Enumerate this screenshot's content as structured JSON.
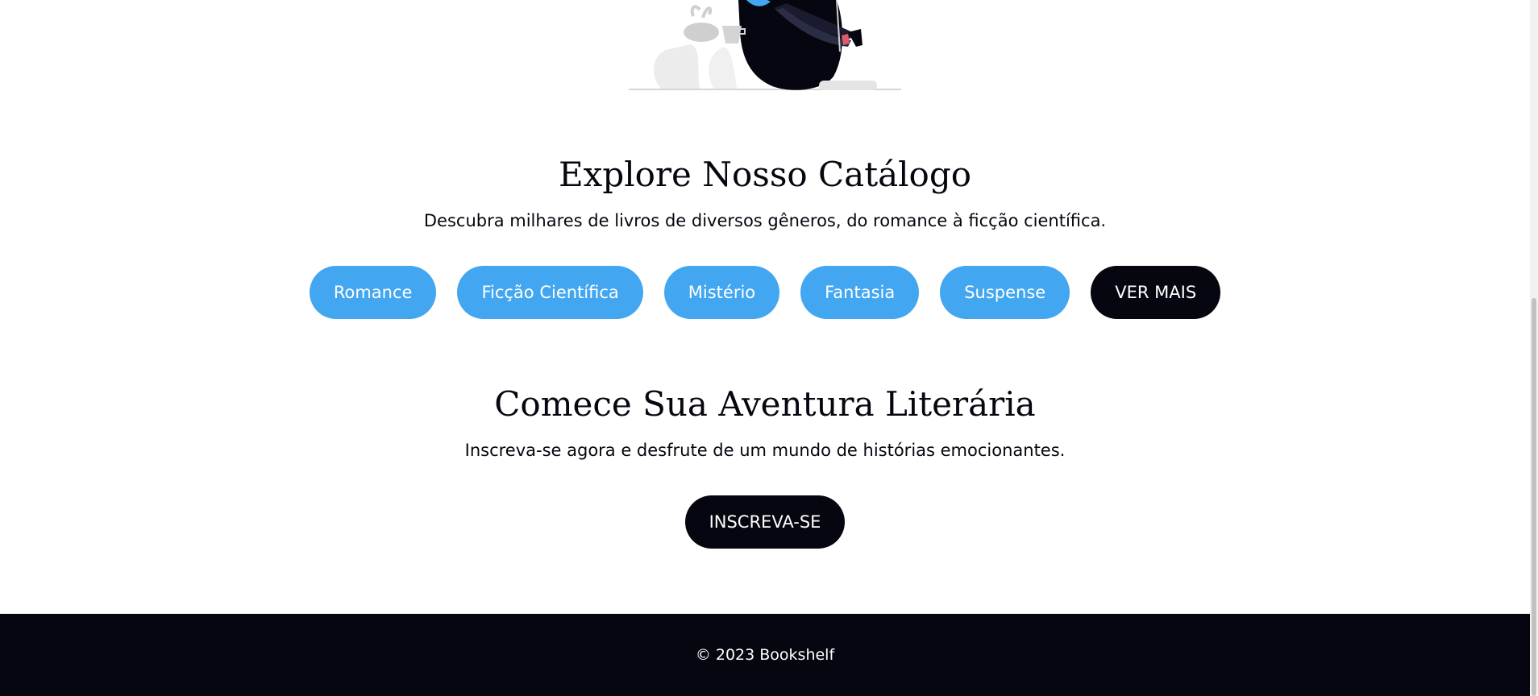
{
  "catalog": {
    "title": "Explore Nosso Catálogo",
    "description": "Descubra milhares de livros de diversos gêneros, do romance à ficção científica.",
    "genres": [
      "Romance",
      "Ficção Científica",
      "Mistério",
      "Fantasia",
      "Suspense"
    ],
    "more_label": "VER MAIS"
  },
  "signup": {
    "title": "Comece Sua Aventura Literária",
    "description": "Inscreva-se agora e desfrute de um mundo de histórias emocionantes.",
    "button_label": "INSCREVA-SE"
  },
  "footer": {
    "copyright": "© 2023 Bookshelf"
  },
  "colors": {
    "accent": "#42a6f0",
    "dark": "#05060f",
    "background": "#ffffff"
  }
}
